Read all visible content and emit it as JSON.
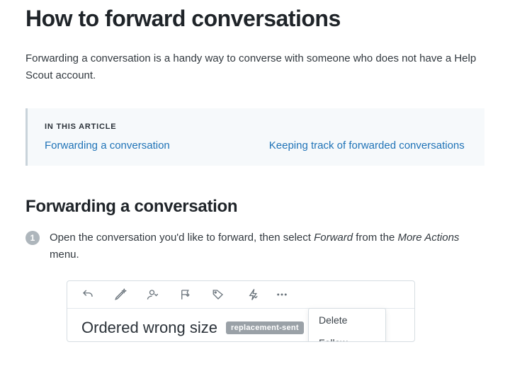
{
  "title": "How to forward conversations",
  "intro": "Forwarding a conversation is a handy way to converse with someone who does not have a Help Scout account.",
  "toc": {
    "heading": "IN THIS ARTICLE",
    "links": [
      "Forwarding a conversation",
      "Keeping track of forwarded conversations"
    ]
  },
  "section1": {
    "heading": "Forwarding a conversation",
    "step_number": "1",
    "step_text_before": "Open the conversation you'd like to forward, then select ",
    "step_text_forward": "Forward",
    "step_text_middle": " from the ",
    "step_text_more": "More Actions",
    "step_text_after": " menu."
  },
  "embed": {
    "dropdown": {
      "item1": "Delete",
      "item2": "Follow"
    },
    "conversation_title": "Ordered wrong size",
    "tag": "replacement-sent"
  }
}
